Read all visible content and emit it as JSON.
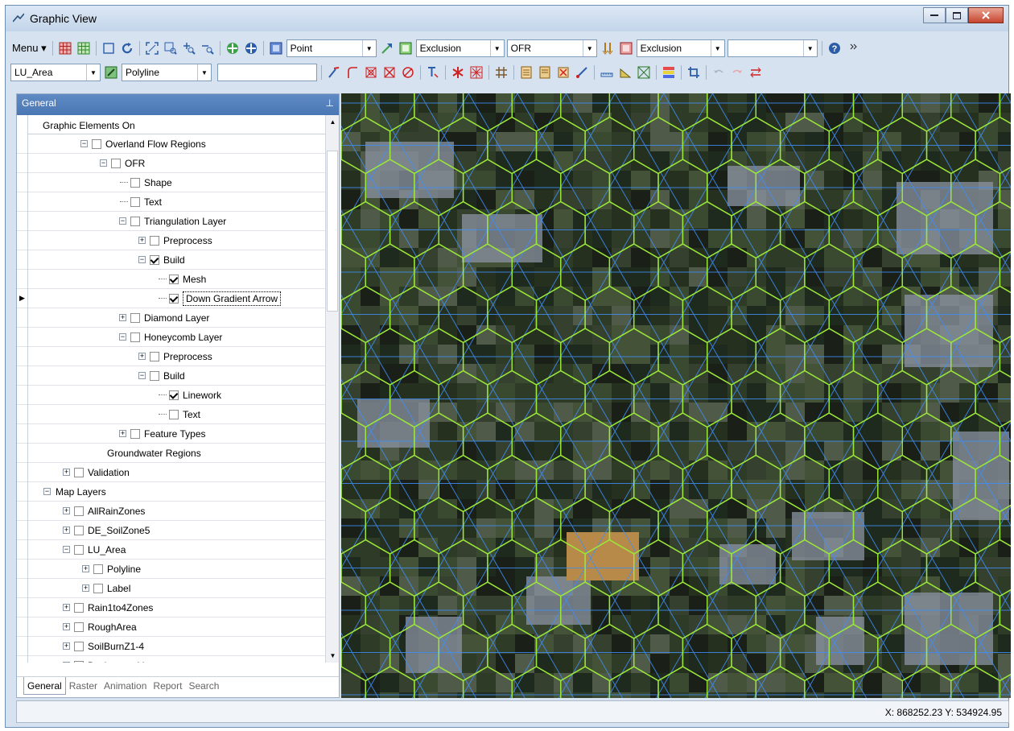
{
  "window": {
    "title": "Graphic View"
  },
  "toolbar1": {
    "menu_label": "Menu",
    "point_combo": "Point",
    "exclusion_combo1": "Exclusion",
    "ofr_combo": "OFR",
    "exclusion_combo2": "Exclusion",
    "empty_combo": ""
  },
  "toolbar2": {
    "layer_combo": "LU_Area",
    "type_combo": "Polyline",
    "text_field": ""
  },
  "panel": {
    "header": "General",
    "column_header": "Graphic Elements On",
    "tree": [
      {
        "label": "Overland Flow Regions",
        "checked": false
      },
      {
        "label": "OFR",
        "checked": false
      },
      {
        "label": "Shape",
        "checked": false
      },
      {
        "label": "Text",
        "checked": false
      },
      {
        "label": "Triangulation Layer",
        "checked": false
      },
      {
        "label": "Preprocess",
        "checked": false
      },
      {
        "label": "Build",
        "checked": true
      },
      {
        "label": "Mesh",
        "checked": true
      },
      {
        "label": "Down Gradient Arrow",
        "checked": true
      },
      {
        "label": "Diamond Layer",
        "checked": false
      },
      {
        "label": "Honeycomb Layer",
        "checked": false
      },
      {
        "label": "Preprocess",
        "checked": false
      },
      {
        "label": "Build",
        "checked": false
      },
      {
        "label": "Linework",
        "checked": true
      },
      {
        "label": "Text",
        "checked": false
      },
      {
        "label": "Feature Types",
        "checked": false
      },
      {
        "label": "Groundwater Regions",
        "checked": false
      },
      {
        "label": "Validation",
        "checked": false
      },
      {
        "label": "Map Layers",
        "checked": false
      },
      {
        "label": "AllRainZones",
        "checked": false
      },
      {
        "label": "DE_SoilZone5",
        "checked": false
      },
      {
        "label": "LU_Area",
        "checked": false
      },
      {
        "label": "Polyline",
        "checked": false
      },
      {
        "label": "Label",
        "checked": false
      },
      {
        "label": "Rain1to4Zones",
        "checked": false
      },
      {
        "label": "RoughArea",
        "checked": false
      },
      {
        "label": "SoilBurnZ1-4",
        "checked": false
      },
      {
        "label": "Background Images",
        "checked": true
      }
    ],
    "tabs": [
      "General",
      "Raster",
      "Animation",
      "Report",
      "Search"
    ]
  },
  "status": {
    "coords": "X: 868252.23  Y: 534924.95"
  },
  "colors": {
    "hex_lines": "#9be63a",
    "tri_lines": "#3f8ff5",
    "panel_header": "#4a77b4"
  }
}
